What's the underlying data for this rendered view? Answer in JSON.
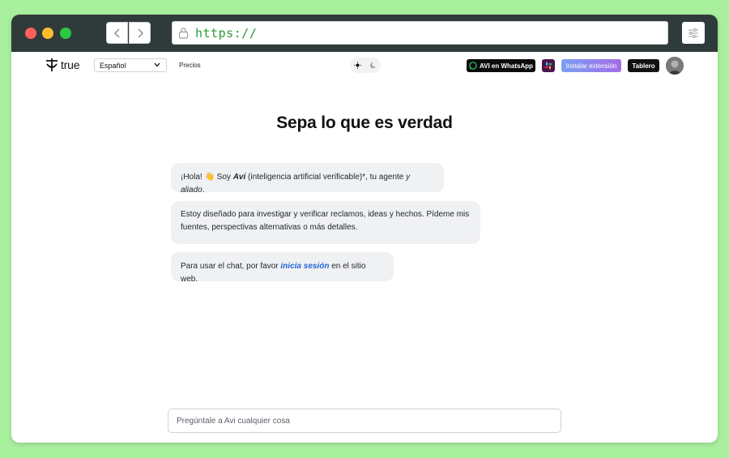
{
  "browser": {
    "url": "https://"
  },
  "header": {
    "brand": "true",
    "language": "Español",
    "prices_link": "Precios",
    "whatsapp_button": "AVI en WhatsApp",
    "extension_button": "Instalar extensión",
    "dashboard_button": "Tablero"
  },
  "main": {
    "title": "Sepa lo que es verdad",
    "messages": {
      "m1": {
        "greeting": "¡Hola! ",
        "wave": "👋",
        "soy": " Soy ",
        "avi": "Avi",
        "desc": " (inteligencia artificial verificable)*, tu agente ",
        "aliado": "y aliado",
        "end": "."
      },
      "m2": {
        "text": "Estoy diseñado para investigar y verificar reclamos, ideas y hechos. Pídeme mis fuentes, perspectivas alternativas o más detalles."
      },
      "m3": {
        "before": "Para usar el chat, por favor ",
        "link": "inicia sesión",
        "after": " en el sitio web."
      }
    },
    "chat_placeholder": "Pregúntale a Avi cualquier cosa"
  },
  "colors": {
    "page_background": "#a8ef9e",
    "titlebar": "#2f3b3b",
    "url_text": "#2e9a3a",
    "link": "#2166d6",
    "bubble": "#f0f1f3"
  },
  "icons": [
    "chevron-left-icon",
    "chevron-right-icon",
    "lock-icon",
    "sliders-icon",
    "logo-icon",
    "chevron-down-icon",
    "sun-icon",
    "moon-icon",
    "whatsapp-icon",
    "slack-icon"
  ]
}
